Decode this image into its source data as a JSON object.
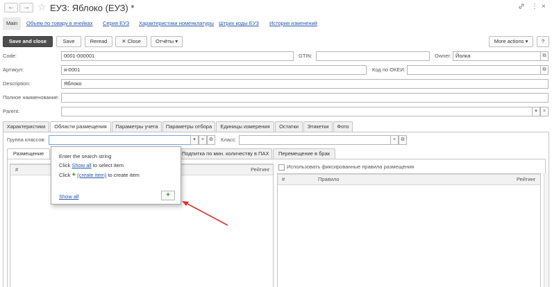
{
  "window": {
    "title": "ЕУЗ: Яблоко (ЕУЗ) *",
    "back_glyph": "←",
    "forward_glyph": "→",
    "star_glyph": "☆",
    "link_glyph": "🔗",
    "more_glyph": "⋮",
    "close_glyph": "×"
  },
  "sections": {
    "main": "Main",
    "s1": "Объем по товару в ячейках",
    "s2": "Серия ЕУЗ",
    "s3": "Характеристики номенклатуры",
    "s4": "Штрих коды ЕУЗ",
    "s5": "История изменений"
  },
  "toolbar": {
    "save_close": "Save and close",
    "save": "Save",
    "reread": "Reread",
    "close": "Close",
    "close_glyph": "✕",
    "reports": "Отчёты",
    "more_actions": "More actions",
    "help": "?",
    "caret": "▾"
  },
  "form": {
    "code_label": "Code:",
    "code_value": "0001-000001",
    "gtin_label": "GTIN:",
    "gtin_value": "",
    "owner_label": "Owner:",
    "owner_value": "Йолка",
    "artikul_label": "Артикул:",
    "artikul_value": "я-0001",
    "okei_label": "Код по ОКЕИ:",
    "okei_value": "",
    "desc_label": "Description:",
    "desc_value": "Яблоко",
    "fullname_label": "Полное наименование:",
    "fullname_value": "",
    "parent_label": "Parent:",
    "parent_value": ""
  },
  "tabs": {
    "t1": "Характеристики",
    "t2": "Области размещения",
    "t3": "Параметры учета",
    "t4": "Параметры отбора",
    "t5": "Единицы измерения",
    "t6": "Остатки",
    "t7": "Этикетки",
    "t8": "Фото"
  },
  "placement": {
    "group_label": "Группа классов:",
    "group_value": "",
    "class_label": "Класс:",
    "class_value": "",
    "subtab1": "Размещение",
    "subtab2": "Подпитка по мин. количеству в ПАХ",
    "subtab3": "Перемещение в брак",
    "left_col_num": "#",
    "left_col_rating": "Рейтинг",
    "fixed_rules_label": "Использовать фиксированные правила размещения",
    "fixed_rules_checked": false,
    "right_col_num": "#",
    "right_col_rule": "Правило",
    "right_col_rating": "Рейтинг"
  },
  "popup": {
    "line1": "Enter the search string",
    "line2_prefix": "Click ",
    "line2_link": "Show all",
    "line2_suffix": " to select item",
    "line3_prefix": "Click ",
    "line3_plus": "+",
    "line3_link": "(create item)",
    "line3_suffix": " to create item",
    "show_all": "Show all",
    "add_button": "+"
  },
  "colors": {
    "link": "#2457a7",
    "primary_button": "#4d4d4d",
    "annotation_arrow": "#e03131",
    "plus_green": "#2c9a2c"
  }
}
